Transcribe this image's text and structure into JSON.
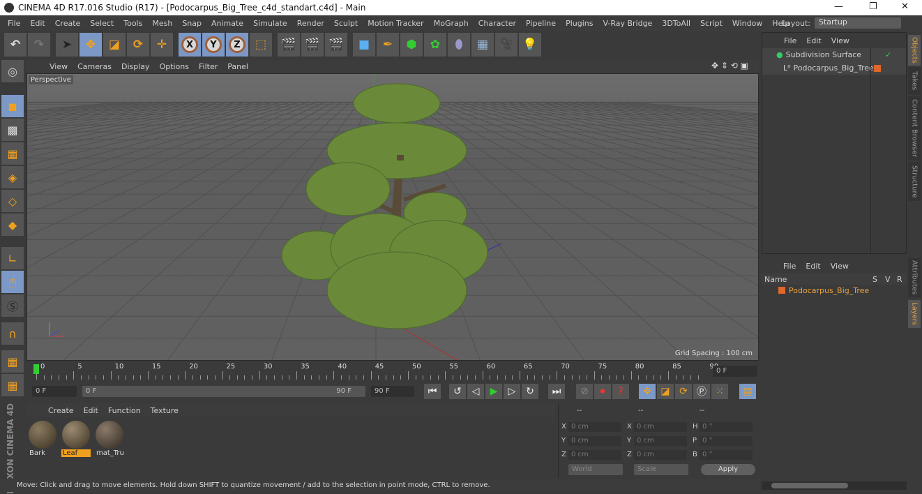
{
  "window": {
    "title": "CINEMA 4D R17.016 Studio (R17) - [Podocarpus_Big_Tree_c4d_standart.c4d] - Main",
    "controls": [
      "—",
      "❐",
      "✕"
    ]
  },
  "menu": [
    "File",
    "Edit",
    "Create",
    "Select",
    "Tools",
    "Mesh",
    "Snap",
    "Animate",
    "Simulate",
    "Render",
    "Sculpt",
    "Motion Tracker",
    "MoGraph",
    "Character",
    "Pipeline",
    "Plugins",
    "V-Ray Bridge",
    "3DToAll",
    "Script",
    "Window",
    "Help"
  ],
  "layout": {
    "label": "Layout:",
    "value": "Startup"
  },
  "toolbar": {
    "axes": [
      "X",
      "Y",
      "Z"
    ]
  },
  "viewport": {
    "menu": [
      "View",
      "Cameras",
      "Display",
      "Options",
      "Filter",
      "Panel"
    ],
    "camera": "Perspective",
    "grid_spacing": "Grid Spacing : 100 cm"
  },
  "timeline": {
    "ticks": [
      "0",
      "5",
      "10",
      "15",
      "20",
      "25",
      "30",
      "35",
      "40",
      "45",
      "50",
      "55",
      "60",
      "65",
      "70",
      "75",
      "80",
      "85",
      "90"
    ],
    "current_frame": "0 F"
  },
  "playback": {
    "start": "0 F",
    "range_start": "0 F",
    "range_end": "90 F",
    "end": "90 F"
  },
  "materials": {
    "menu": [
      "Create",
      "Edit",
      "Function",
      "Texture"
    ],
    "items": [
      {
        "name": "Bark",
        "selected": false
      },
      {
        "name": "Leaf",
        "selected": true
      },
      {
        "name": "mat_Tru",
        "selected": false
      }
    ]
  },
  "coordinates": {
    "headers": [
      "--",
      "--",
      "--"
    ],
    "rows": [
      [
        "X",
        "0 cm",
        "X",
        "0 cm",
        "H",
        "0 °"
      ],
      [
        "Y",
        "0 cm",
        "Y",
        "0 cm",
        "P",
        "0 °"
      ],
      [
        "Z",
        "0 cm",
        "Z",
        "0 cm",
        "B",
        "0 °"
      ]
    ],
    "mode": "World",
    "type": "Scale",
    "apply": "Apply"
  },
  "status": "Move: Click and drag to move elements. Hold down SHIFT to quantize movement / add to the selection in point mode, CTRL to remove.",
  "objects": {
    "menu": [
      "File",
      "Edit",
      "View"
    ],
    "items": [
      {
        "name": "Subdivision Surface"
      },
      {
        "name": "Podocarpus_Big_Tree"
      }
    ]
  },
  "layers": {
    "menu": [
      "File",
      "Edit",
      "View"
    ],
    "columns": [
      "Name",
      "S",
      "V",
      "R"
    ],
    "items": [
      {
        "name": "Podocarpus_Big_Tree",
        "color": "#e0662a"
      }
    ]
  },
  "side_tabs": [
    "Objects",
    "Takes",
    "Content Browser",
    "Structure",
    "Attributes",
    "Layers"
  ],
  "colors": {
    "accent": "#e8a040",
    "selection": "#7b98c6",
    "layer": "#e0662a"
  }
}
